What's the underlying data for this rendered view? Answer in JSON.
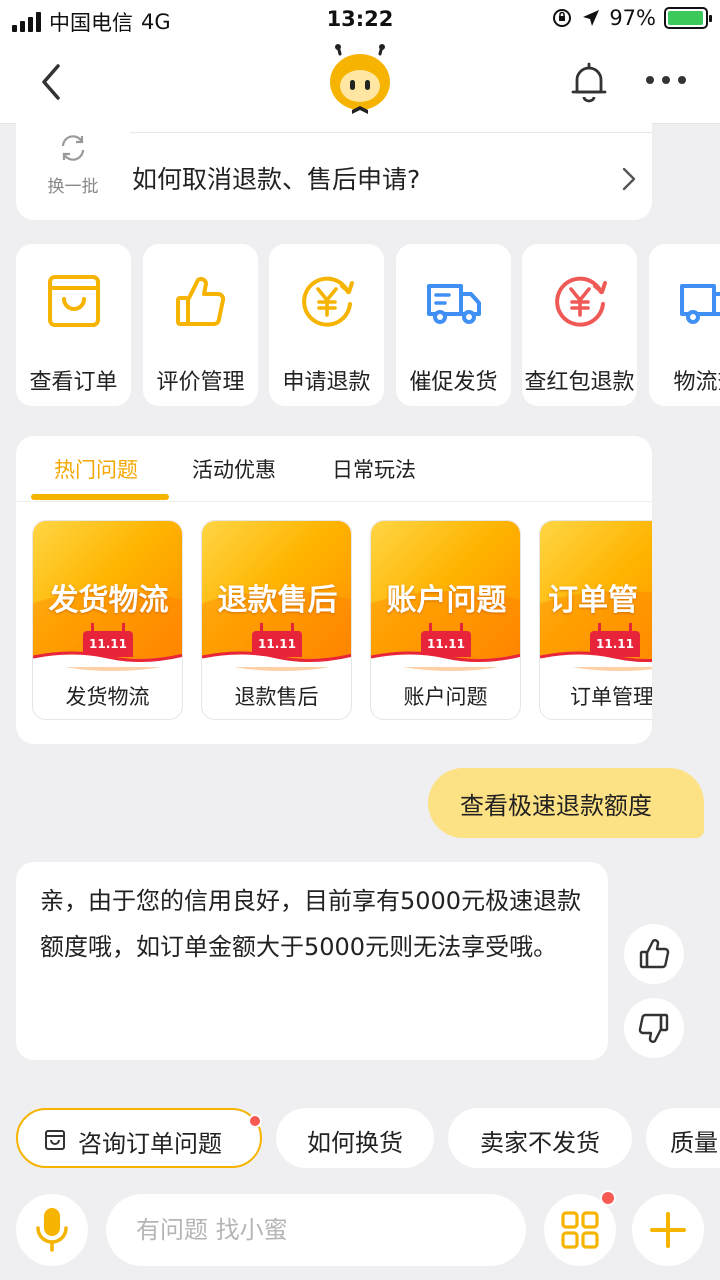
{
  "status_bar": {
    "carrier": "中国电信",
    "network": "4G",
    "time": "13:22",
    "battery": "97%",
    "battery_level": 0.97
  },
  "question_card": {
    "refresh_label": "换一批",
    "question": "如何取消退款、售后申请?"
  },
  "shortcuts": [
    {
      "label": "查看订单",
      "icon": "order-box-icon",
      "color": "#f6b400"
    },
    {
      "label": "评价管理",
      "icon": "thumb-up-icon",
      "color": "#f6b400"
    },
    {
      "label": "申请退款",
      "icon": "yuan-refund-icon",
      "color": "#f6b400"
    },
    {
      "label": "催促发货",
      "icon": "delivery-truck-icon",
      "color": "#3f8ff5"
    },
    {
      "label": "查红包退款",
      "icon": "red-packet-refund-icon",
      "color": "#ef5a57"
    },
    {
      "label": "物流查",
      "icon": "logistics-truck-icon",
      "color": "#3f8ff5"
    }
  ],
  "topics": {
    "tabs": [
      "热门问题",
      "活动优惠",
      "日常玩法"
    ],
    "active_tab": "热门问题",
    "tiles": [
      {
        "banner": "发货物流",
        "label": "发货物流"
      },
      {
        "banner": "退款售后",
        "label": "退款售后"
      },
      {
        "banner": "账户问题",
        "label": "账户问题"
      },
      {
        "banner": "订单管",
        "label": "订单管理"
      }
    ],
    "badge_text": "11.11"
  },
  "chat": {
    "user_message": "查看极速退款额度",
    "bot_message": "亲，由于您的信用良好，目前享有5000元极速退款额度哦，如订单金额大于5000元则无法享受哦。"
  },
  "quick_chips": [
    {
      "label": "咨询订单问题",
      "icon": "order-box-icon"
    },
    {
      "label": "如何换货"
    },
    {
      "label": "卖家不发货"
    },
    {
      "label": "质量"
    }
  ],
  "input": {
    "placeholder": "有问题 找小蜜"
  },
  "colors": {
    "accent": "#f6b400",
    "user_bubble": "#fde185",
    "badge_dot": "#f65a52",
    "blue": "#3f8ff5",
    "red": "#ef5a57"
  }
}
